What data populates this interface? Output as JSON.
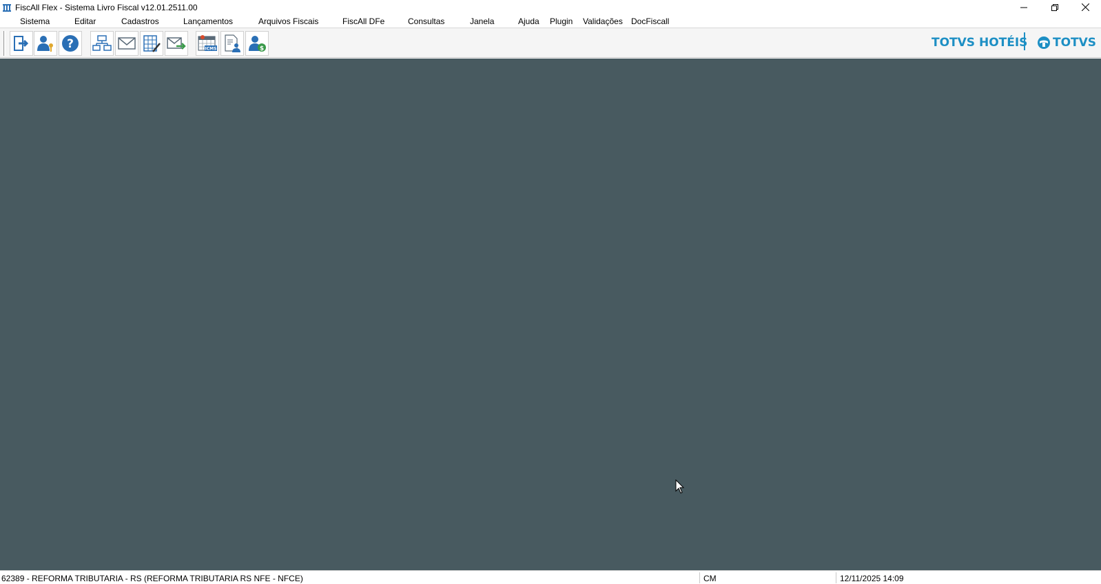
{
  "window": {
    "title": "FiscAll Flex - Sistema Livro Fiscal v12.01.2511.00",
    "icon": "app-building-icon",
    "controls": [
      "minimize-icon",
      "restore-icon",
      "close-icon"
    ]
  },
  "menu": {
    "items": [
      {
        "label": "Sistema"
      },
      {
        "label": "Editar"
      },
      {
        "label": "Cadastros"
      },
      {
        "label": "Lançamentos"
      },
      {
        "label": "Arquivos Fiscais"
      },
      {
        "label": "FiscAll DFe"
      },
      {
        "label": "Consultas"
      },
      {
        "label": "Janela"
      },
      {
        "label": "Ajuda"
      },
      {
        "label": "Plugin"
      },
      {
        "label": "Validações"
      },
      {
        "label": "DocFiscall"
      }
    ]
  },
  "toolbar": {
    "buttons": [
      {
        "icon": "exit-door-icon"
      },
      {
        "icon": "user-key-icon"
      },
      {
        "icon": "help-icon"
      },
      {
        "icon": "org-chart-icon"
      },
      {
        "icon": "envelope-icon"
      },
      {
        "icon": "spreadsheet-edit-icon"
      },
      {
        "icon": "send-mail-icon"
      },
      {
        "icon": "calendar-icms-icon"
      },
      {
        "icon": "document-user-icon"
      },
      {
        "icon": "user-money-icon"
      }
    ],
    "brand_hoteis": "TOTVS HOTÉIS",
    "brand_totvs": "TOTVS",
    "brand_color": "#1d8fc4"
  },
  "workspace": {
    "background": "#485a60"
  },
  "status": {
    "company": "62389 - REFORMA TRIBUTARIA - RS (REFORMA TRIBUTARIA RS NFE - NFCE)",
    "module": "CM",
    "datetime": "12/11/2025 14:09"
  }
}
